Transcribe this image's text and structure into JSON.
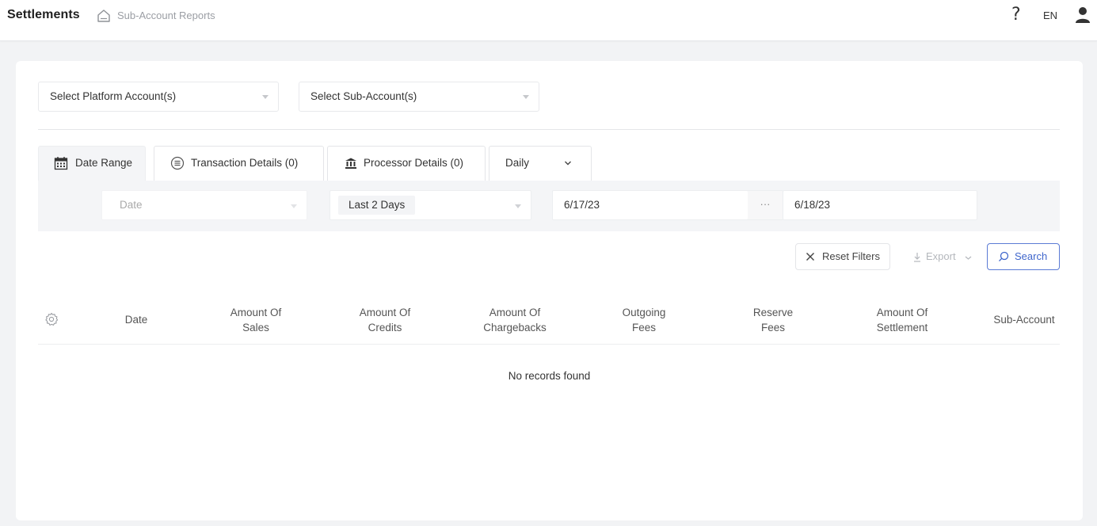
{
  "header": {
    "title": "Settlements",
    "breadcrumb": "Sub-Account Reports",
    "help_label": "?",
    "language": "EN"
  },
  "filters": {
    "platform_account_placeholder": "Select Platform Account(s)",
    "sub_account_placeholder": "Select Sub-Account(s)"
  },
  "tabs": [
    {
      "label": "Date Range",
      "icon": "calendar-icon"
    },
    {
      "label": "Transaction Details (0)",
      "icon": "list-circle-icon"
    },
    {
      "label": "Processor Details (0)",
      "icon": "bank-icon"
    },
    {
      "label": "Daily",
      "icon": "chevron-down-icon"
    }
  ],
  "date_filter": {
    "field": "Date",
    "range": "Last 2 Days",
    "start": "6/17/23",
    "separator": "···",
    "end": "6/18/23"
  },
  "actions": {
    "reset": "Reset Filters",
    "export": "Export",
    "search": "Search"
  },
  "table": {
    "columns": [
      [
        "Date"
      ],
      [
        "Amount Of",
        "Sales"
      ],
      [
        "Amount Of",
        "Credits"
      ],
      [
        "Amount Of",
        "Chargebacks"
      ],
      [
        "Outgoing",
        "Fees"
      ],
      [
        "Reserve",
        "Fees"
      ],
      [
        "Amount Of",
        "Settlement"
      ],
      [
        "Sub-Account"
      ]
    ],
    "empty_message": "No records found"
  },
  "colors": {
    "accent": "#3f66cc",
    "background": "#f2f3f5",
    "panel": "#f4f5f7"
  }
}
